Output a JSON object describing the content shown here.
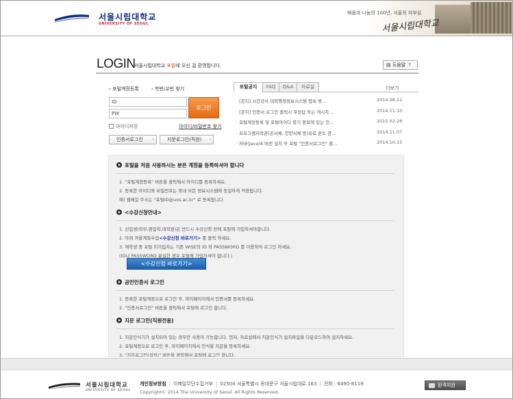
{
  "header": {
    "logo_ko": "서울시립대학교",
    "logo_en": "UNIVERSITY OF SEOUL",
    "slogan": "배움과 나눔의 100년, 서울의 자부심",
    "slogan_script": "서울시립대학교"
  },
  "login": {
    "heading": "LOGIN",
    "welcome_prefix": "서울시립대학교 ",
    "welcome_highlight": "포털",
    "welcome_suffix": "에 오신 걸 환영합니다.",
    "help_label": "도움말",
    "help_q": "?",
    "link_register": "포털계정등록",
    "link_student_id": "학번/교번 찾기",
    "id_value": "ID",
    "pw_value": "PW",
    "login_button": "로그인",
    "save_id": "아이디저장",
    "find_idpw": "아이디/비밀번호 찾기",
    "cert_login": "인증서로그인",
    "finger_login": "지문로그인(직원)",
    "arrow": "›"
  },
  "notice": {
    "tabs": [
      "포털공지",
      "FAQ",
      "Q&A",
      "자료실"
    ],
    "active_tab": 0,
    "more": "더보기",
    "items": [
      {
        "title": "· [공지] 시간강사 대학행정정보시스템 접속 방...",
        "date": "2014.08.11"
      },
      {
        "title": "· [공지] 인증서 로그인 클릭시 무응답 또는 게시자...",
        "date": "2014.11.10"
      },
      {
        "title": "· 포털계정등록 및 포털아이디 찾기 항목에 있는 인...",
        "date": "2015.02.28"
      },
      {
        "title": "· 프로그램저작권(공서체, 한양서체 등)유료 폰트 관...",
        "date": "2014.11.07"
      },
      {
        "title": "· 자바(Java)8 버전 설치 후 포털 \"인증서로그인\" 클...",
        "date": "2014.10.15"
      }
    ]
  },
  "guide": {
    "first": {
      "title": "포털을 처음 사용하시는 분은 계정을 등록하셔야 합니다",
      "items": [
        "1.  \"포털계정등록\" 버튼을 클릭해서 아이디를 등록하세요.",
        "2.  등록한 아이디와 비밀번호는 학내 모든 정보시스템에 동일하게 적용됩니다.",
        "     예) 웹메일 주소는 \"포털ID@uos.ac.kr\" 로 등록됩니다."
      ]
    },
    "enroll": {
      "title": "<수강신청안내>",
      "item1": "1.  신입생(학부,편입학,대학원)은 반드시 수강신청 전에 포털에 가입하셔야합니다.",
      "item2_prefix": "2.  아래 겨울계절수업",
      "item2_link": "<수강신청 바로가기>",
      "item2_suffix": " 를 클릭 하세요.",
      "item3": "3.  재학생 중 포털 미가입자는 기존 WISE의 ID 와 PASSWORD 를 이용하여 로그인 하세요.",
      "item3b": "     (ID나 PASSWORD 분실한 경우 포털에 가입하셔야 합니다.)",
      "button": "<수강신청 바로가기>"
    },
    "cert": {
      "title": "공인인증서 로그인",
      "items": [
        "1.  등록한 포털계정으로 로그인 후, 마이페이지에서 인증서를 등록하세요.",
        "2.  \"인증서로그인\" 버튼을 클릭해서 포털에 로그인 합니다."
      ]
    },
    "finger": {
      "title": "지문 로그인(직원전용)",
      "items": [
        "1.  지문인식기가 설치되어 있는 경우만 사용이 가능합니다. 먼저, 자료실에서 지문인식기 설치파일을 다운로드하여 설치하세요.",
        "2.  포털계정으로 로그인 후, 마이페이지에서 인식할 지문을 등록하세요.",
        "3.  \"지문로그인(직원)\" 버튼을 클릭해서 포털에 로그인 합니다."
      ]
    }
  },
  "footer": {
    "logo_ko": "서울시립대학교",
    "logo_en": "UNIVERSITY OF SEOUL",
    "privacy": "개인정보방침",
    "email_refuse": "이메일무단수집거부",
    "address": "02504 서울특별시 동대문구 서울시립대로 163",
    "phone": "전화 : 6490-6119",
    "copyright": "Copyright© 2014 The University of Seoul. All Rights Reserved.",
    "remote": "원격지원"
  },
  "colors": {
    "accent_orange": "#e36a16",
    "brand_navy": "#0e2a86",
    "link_blue": "#1837b5"
  }
}
